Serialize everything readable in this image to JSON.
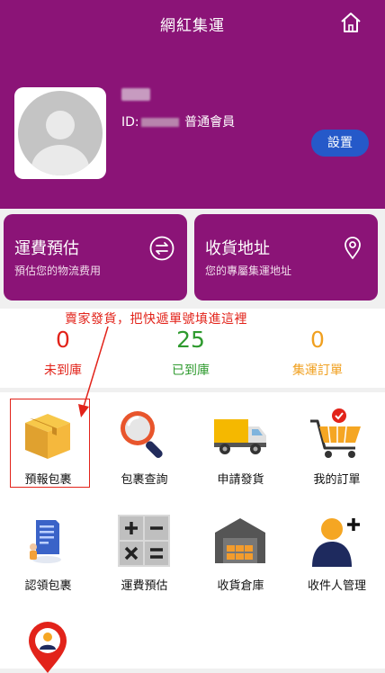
{
  "header": {
    "title": "網紅集運"
  },
  "profile": {
    "id_prefix": "ID:",
    "id_suffix": "普通會員",
    "settings_label": "設置"
  },
  "cards": [
    {
      "title": "運費預估",
      "subtitle": "預估您的物流费用"
    },
    {
      "title": "收貨地址",
      "subtitle": "您的專屬集運地址"
    }
  ],
  "annotation": "賣家發貨，把快遞單號填進這裡",
  "stats": [
    {
      "value": "0",
      "label": "未到庫",
      "color": "#e2231a"
    },
    {
      "value": "25",
      "label": "已到庫",
      "color": "#2e9a2e"
    },
    {
      "value": "0",
      "label": "集運訂單",
      "color": "#f0a020"
    }
  ],
  "grid": [
    {
      "label": "預報包裹",
      "icon": "package-box-icon"
    },
    {
      "label": "包裹查詢",
      "icon": "magnifier-icon"
    },
    {
      "label": "申請發貨",
      "icon": "delivery-truck-icon"
    },
    {
      "label": "我的訂單",
      "icon": "shopping-cart-icon"
    },
    {
      "label": "認領包裹",
      "icon": "claim-document-icon"
    },
    {
      "label": "運費預估",
      "icon": "calculator-icon"
    },
    {
      "label": "收貨倉庫",
      "icon": "warehouse-icon"
    },
    {
      "label": "收件人管理",
      "icon": "add-recipient-icon"
    },
    {
      "label": "",
      "icon": "location-person-icon"
    }
  ]
}
